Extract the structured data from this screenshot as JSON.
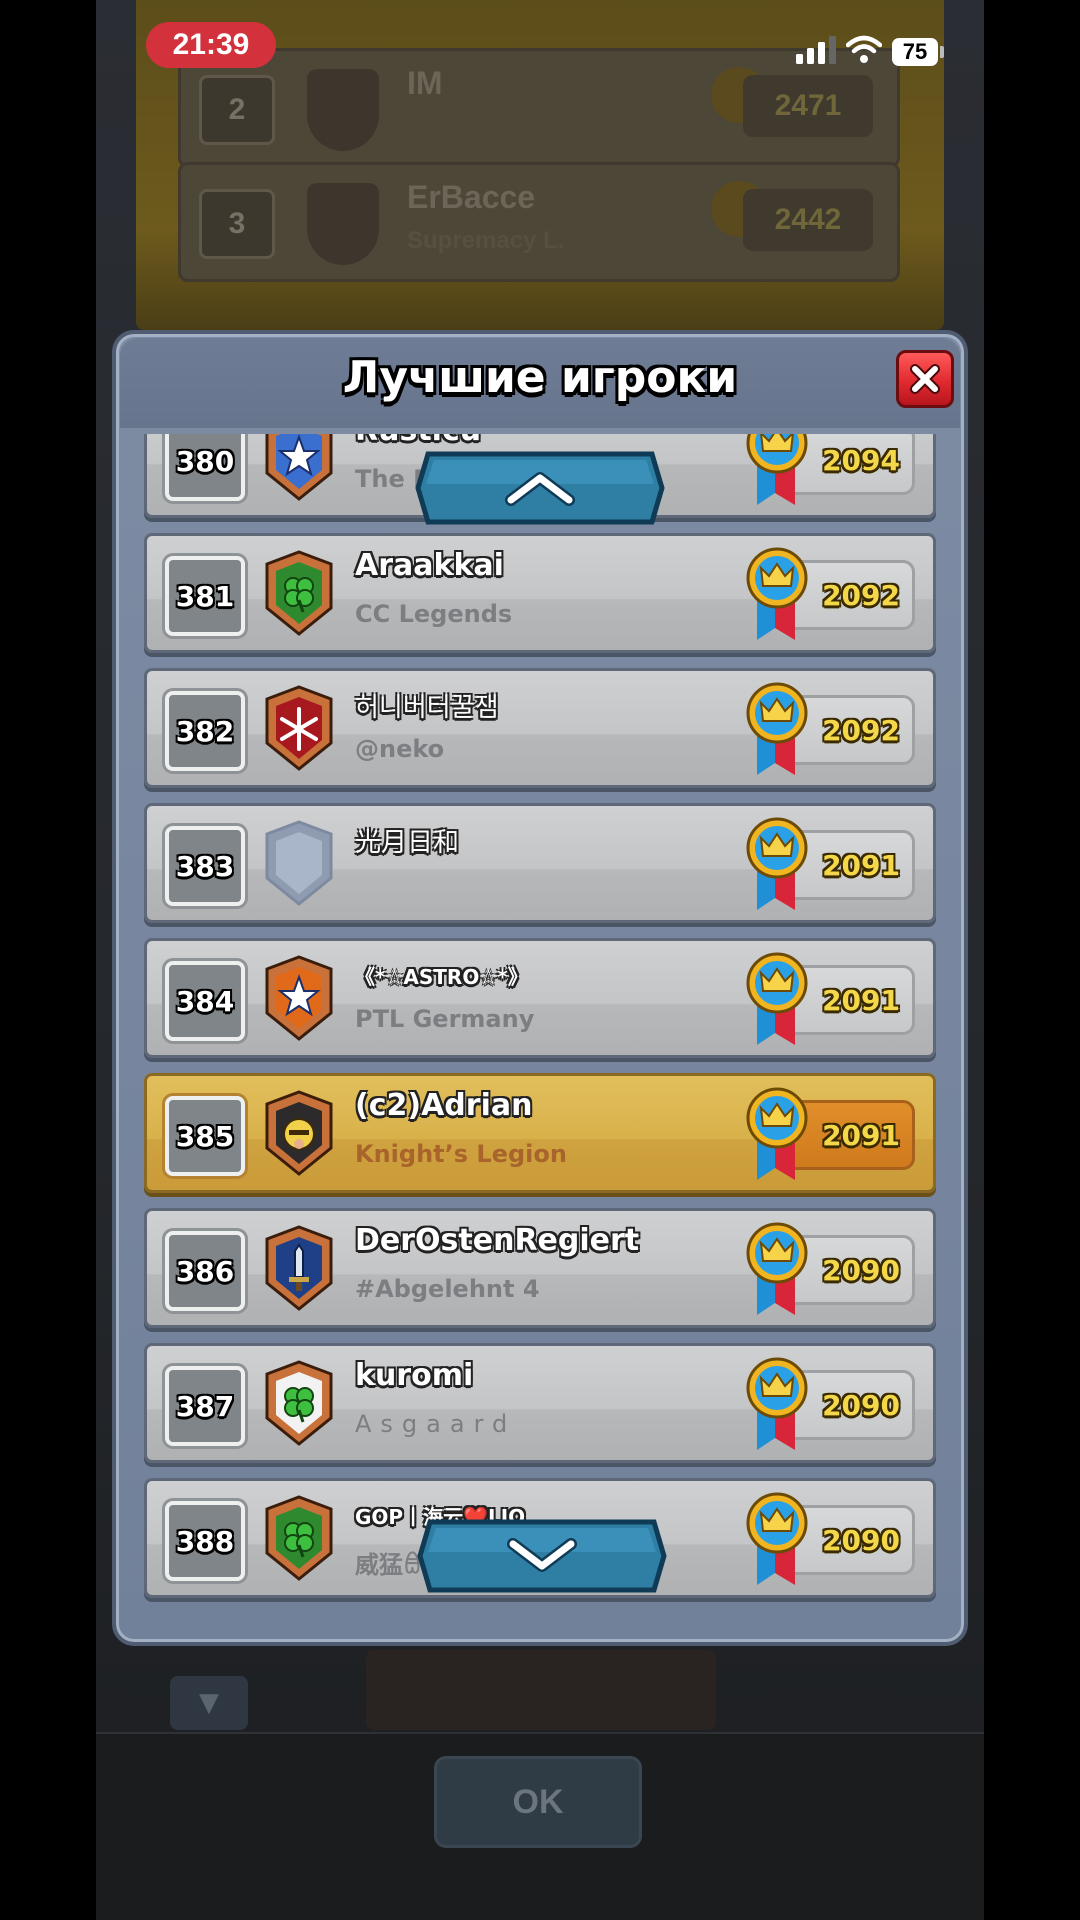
{
  "status_bar": {
    "time": "21:39",
    "battery": "75"
  },
  "background": {
    "rows": [
      {
        "rank": "2",
        "name": "IM",
        "clan": "",
        "score": "2471"
      },
      {
        "rank": "3",
        "name": "ErBacce",
        "clan": "Supremacy L.",
        "score": "2442"
      }
    ],
    "ok_label": "OK"
  },
  "modal": {
    "title": "Лучшие игроки",
    "close_icon": "close-x-icon",
    "players": [
      {
        "rank": "380",
        "name": "Rusticu",
        "clan": "The R",
        "score": "2094",
        "badge_color": "#3a6fd0",
        "badge_symbol": "star"
      },
      {
        "rank": "381",
        "name": "Araakkai",
        "clan": "CC Legends",
        "score": "2092",
        "badge_color": "#2f8a2f",
        "badge_symbol": "clover"
      },
      {
        "rank": "382",
        "name": "허니버터꿀잼",
        "clan": "@neko",
        "score": "2092",
        "badge_color": "#a8191f",
        "badge_symbol": "snowflake"
      },
      {
        "rank": "383",
        "name": "光月日和",
        "clan": "",
        "score": "2091",
        "badge_color": "#a9b6c9",
        "badge_symbol": "none"
      },
      {
        "rank": "384",
        "name": "《*☆ASTRO☆*》",
        "clan": "PTL Germany",
        "score": "2091",
        "badge_color": "#e06a1a",
        "badge_symbol": "star"
      },
      {
        "rank": "385",
        "name": "(c2)Adrian",
        "clan": "Knight’s Legion",
        "score": "2091",
        "badge_color": "#2c2a2a",
        "badge_symbol": "knight",
        "highlight": true
      },
      {
        "rank": "386",
        "name": "DerOstenRegiert",
        "clan": "#Abgelehnt 4",
        "score": "2090",
        "badge_color": "#1f3f86",
        "badge_symbol": "sword"
      },
      {
        "rank": "387",
        "name": "kuromi",
        "clan": "Asgaard",
        "score": "2090",
        "badge_color": "#f2f2f2",
        "badge_symbol": "clover"
      },
      {
        "rank": "388",
        "name": "GOP丨海云❤️LJQ",
        "clan": "威猛ꎂ",
        "score": "2090",
        "badge_color": "#2f8a2f",
        "badge_symbol": "clover"
      }
    ]
  },
  "icons": {
    "scroll_up": "chevron-up-icon",
    "scroll_down": "chevron-down-icon",
    "trophy_medal": "crown-medal-icon"
  }
}
